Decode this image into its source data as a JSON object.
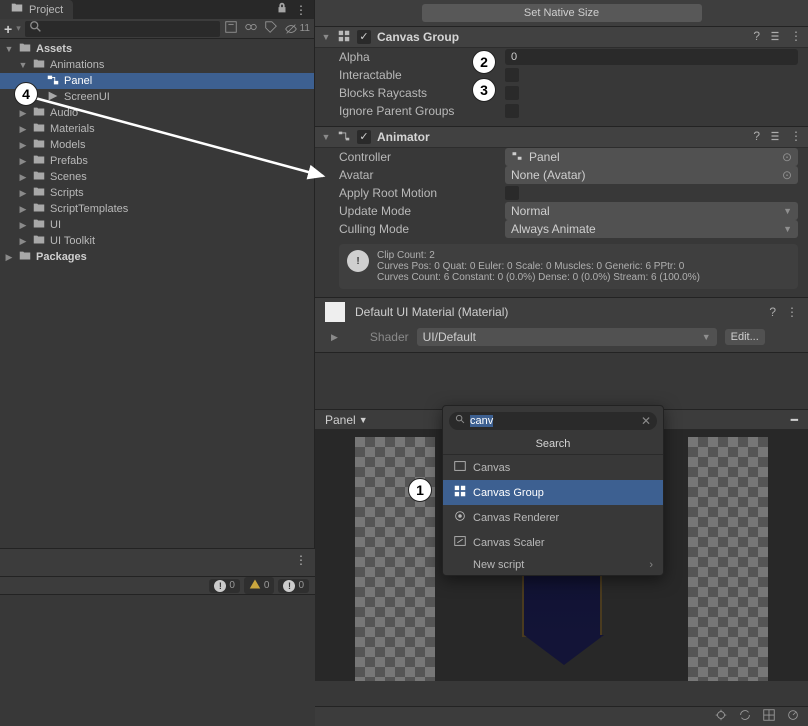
{
  "project": {
    "tab_label": "Project",
    "eye_count": "11",
    "tree": {
      "assets": "Assets",
      "animations": "Animations",
      "panel": "Panel",
      "screenui": "ScreenUI",
      "audio": "Audio",
      "materials": "Materials",
      "models": "Models",
      "prefabs": "Prefabs",
      "scenes": "Scenes",
      "scripts": "Scripts",
      "scripttemplates": "ScriptTemplates",
      "ui": "UI",
      "uitoolkit": "UI Toolkit",
      "packages": "Packages"
    }
  },
  "console": {
    "info": "0",
    "warn": "0",
    "error": "0"
  },
  "inspector": {
    "set_native_size": "Set Native Size",
    "canvas_group": {
      "title": "Canvas Group",
      "alpha_label": "Alpha",
      "alpha_value": "0",
      "interactable_label": "Interactable",
      "blocks_label": "Blocks Raycasts",
      "ignore_label": "Ignore Parent Groups"
    },
    "animator": {
      "title": "Animator",
      "controller_label": "Controller",
      "controller_value": "Panel",
      "avatar_label": "Avatar",
      "avatar_value": "None (Avatar)",
      "apply_root_label": "Apply Root Motion",
      "update_mode_label": "Update Mode",
      "update_mode_value": "Normal",
      "culling_label": "Culling Mode",
      "culling_value": "Always Animate",
      "info_line1": "Clip Count: 2",
      "info_line2": "Curves Pos: 0 Quat: 0 Euler: 0 Scale: 0 Muscles: 0 Generic: 6 PPtr: 0",
      "info_line3": "Curves Count: 6 Constant: 0 (0.0%) Dense: 0 (0.0%) Stream: 6 (100.0%)"
    },
    "material": {
      "title": "Default UI Material (Material)",
      "shader_label": "Shader",
      "shader_value": "UI/Default",
      "edit_btn": "Edit..."
    },
    "preview_label": "Panel"
  },
  "search_popup": {
    "query": "canv",
    "title": "Search",
    "items": {
      "canvas": "Canvas",
      "canvas_group": "Canvas Group",
      "canvas_renderer": "Canvas Renderer",
      "canvas_scaler": "Canvas Scaler",
      "new_script": "New script"
    }
  },
  "callouts": {
    "c1": "1",
    "c2": "2",
    "c3": "3",
    "c4": "4"
  }
}
